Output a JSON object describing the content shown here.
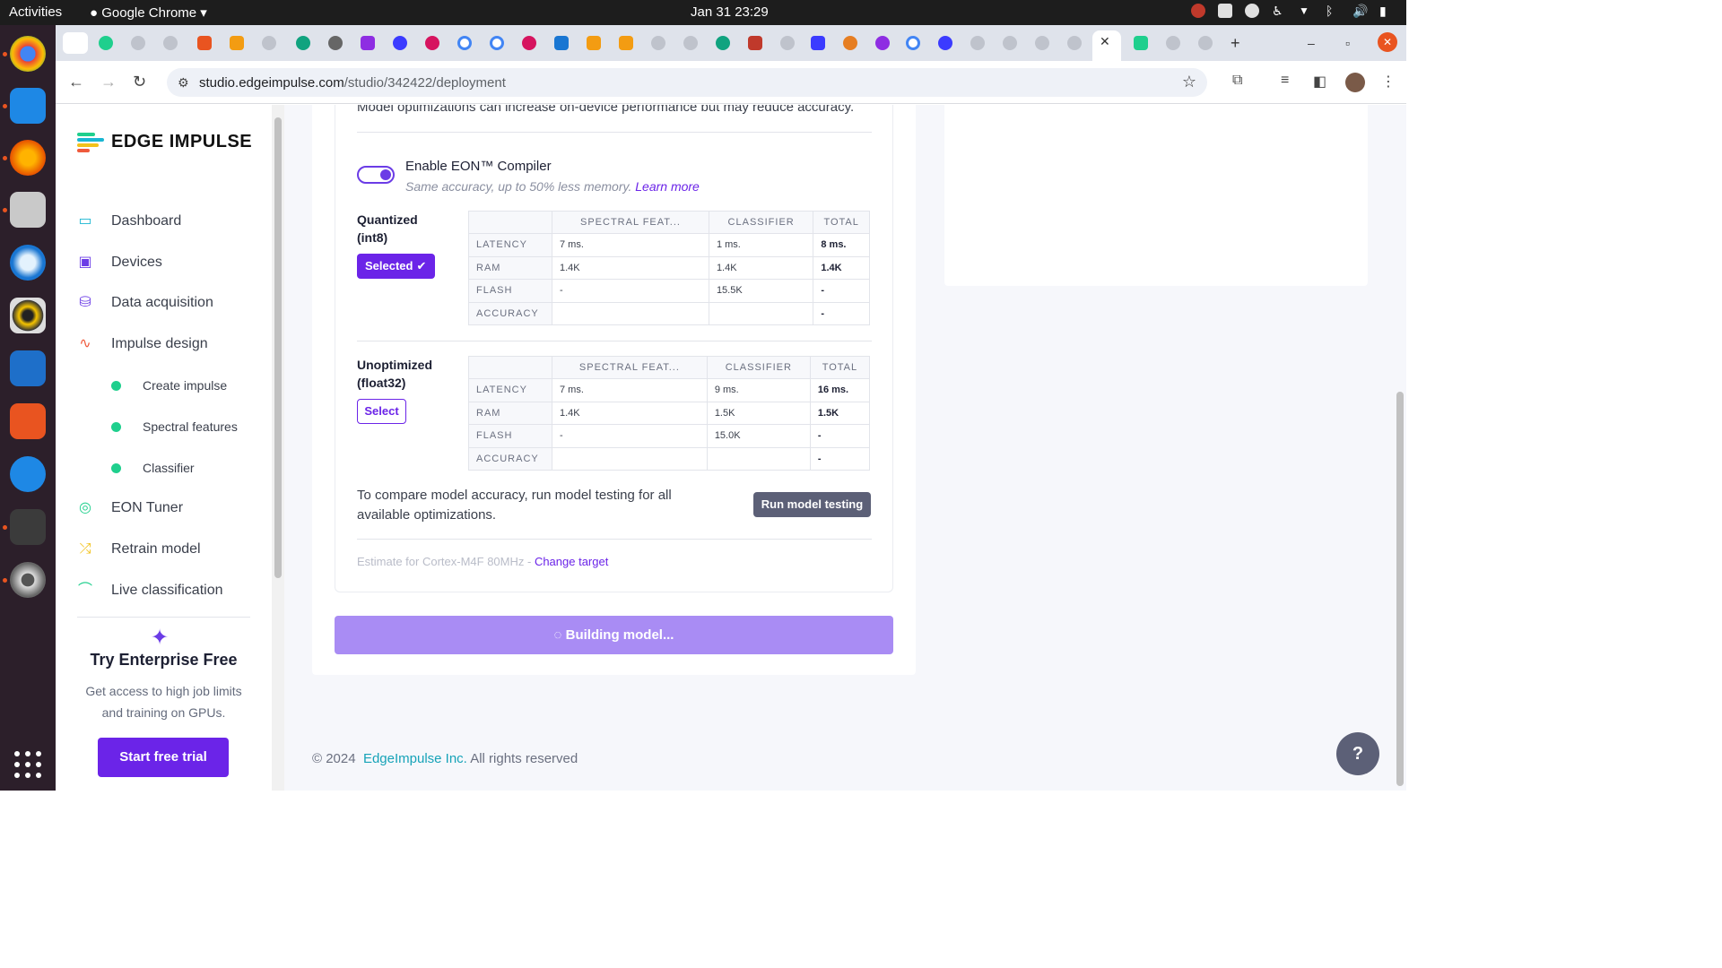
{
  "system": {
    "activities": "Activities",
    "app_menu": "Google Chrome",
    "clock": "Jan 31  23:29"
  },
  "browser": {
    "url_host": "studio.edgeimpulse.com",
    "url_path": "/studio/342422/deployment"
  },
  "sidebar": {
    "logo_text": "EDGE IMPULSE",
    "items": [
      {
        "label": "Dashboard",
        "icon": "monitor-icon",
        "color": "#19b6d2"
      },
      {
        "label": "Devices",
        "icon": "chip-icon",
        "color": "#6b3ce6"
      },
      {
        "label": "Data acquisition",
        "icon": "database-icon",
        "color": "#6b3ce6"
      },
      {
        "label": "Impulse design",
        "icon": "pulse-icon",
        "color": "#ef5a3c"
      }
    ],
    "sub_items": [
      {
        "label": "Create impulse"
      },
      {
        "label": "Spectral features"
      },
      {
        "label": "Classifier"
      }
    ],
    "items2": [
      {
        "label": "EON Tuner",
        "icon": "compass-icon",
        "color": "#1fcf8d"
      },
      {
        "label": "Retrain model",
        "icon": "shuffle-icon",
        "color": "#f2c21b"
      },
      {
        "label": "Live classification",
        "icon": "graph-icon",
        "color": "#1fcf8d"
      }
    ],
    "enterprise": {
      "title": "Try Enterprise Free",
      "description": "Get access to high job limits and training on GPUs.",
      "button": "Start free trial"
    }
  },
  "main": {
    "top_text": "Model optimizations can increase on-device performance but may reduce accuracy.",
    "eon": {
      "title": "Enable EON™ Compiler",
      "description": "Same accuracy, up to 50% less memory.",
      "link": "Learn more",
      "enabled": true
    },
    "columns": [
      "SPECTRAL FEAT...",
      "CLASSIFIER",
      "TOTAL"
    ],
    "quantized": {
      "label_line1": "Quantized",
      "label_line2": "(int8)",
      "button": "Selected",
      "rows": [
        {
          "name": "LATENCY",
          "spectral": "7 ms.",
          "classifier": "1 ms.",
          "total": "8 ms."
        },
        {
          "name": "RAM",
          "spectral": "1.4K",
          "classifier": "1.4K",
          "total": "1.4K"
        },
        {
          "name": "FLASH",
          "spectral": "-",
          "classifier": "15.5K",
          "total": "-"
        },
        {
          "name": "ACCURACY",
          "spectral": "",
          "classifier": "",
          "total": "-"
        }
      ]
    },
    "unoptimized": {
      "label_line1": "Unoptimized",
      "label_line2": "(float32)",
      "button": "Select",
      "rows": [
        {
          "name": "LATENCY",
          "spectral": "7 ms.",
          "classifier": "9 ms.",
          "total": "16 ms."
        },
        {
          "name": "RAM",
          "spectral": "1.4K",
          "classifier": "1.5K",
          "total": "1.5K"
        },
        {
          "name": "FLASH",
          "spectral": "-",
          "classifier": "15.0K",
          "total": "-"
        },
        {
          "name": "ACCURACY",
          "spectral": "",
          "classifier": "",
          "total": "-"
        }
      ]
    },
    "compare_text": "To compare model accuracy, run model testing for all available optimizations.",
    "run_button": "Run model testing",
    "estimate_text": "Estimate for Cortex-M4F 80MHz - ",
    "change_target": "Change target",
    "build_button": "Building model..."
  },
  "footer": {
    "prefix": "© 2024",
    "brand": "EdgeImpulse Inc.",
    "suffix": "All rights reserved"
  },
  "help_button": "?"
}
